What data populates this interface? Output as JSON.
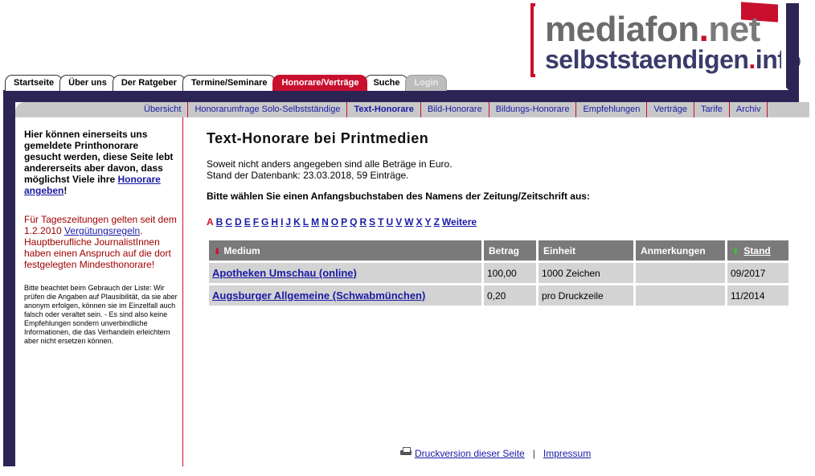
{
  "logo": {
    "line1_a": "mediafon",
    "line1_dot": ".",
    "line1_b": "net",
    "line2_a": "selbststaendigen",
    "line2_dot": ".",
    "line2_b": "info"
  },
  "tabs": [
    {
      "label": "Startseite"
    },
    {
      "label": "Über uns"
    },
    {
      "label": "Der Ratgeber"
    },
    {
      "label": "Termine/Seminare"
    },
    {
      "label": "Honorare/Verträge",
      "active": true
    },
    {
      "label": "Suche"
    },
    {
      "label": "Login",
      "disabled": true
    }
  ],
  "subnav": [
    {
      "label": "Übersicht"
    },
    {
      "label": "Honorarumfrage Solo-Selbstständige"
    },
    {
      "label": "Text-Honorare",
      "active": true
    },
    {
      "label": "Bild-Honorare"
    },
    {
      "label": "Bildungs-Honorare"
    },
    {
      "label": "Empfehlungen"
    },
    {
      "label": "Verträge"
    },
    {
      "label": "Tarife"
    },
    {
      "label": "Archiv"
    }
  ],
  "sidebar": {
    "intro": "Hier können einerseits uns gemeldete Printhonorare gesucht werden, diese Seite lebt andererseits aber davon, dass möglichst Viele ihre",
    "intro_link": "Honorare angeben",
    "intro_end": "!",
    "tz_start": "Für Tageszeitungen gelten seit dem 1.2.2010 ",
    "tz_link": "Vergütungsregeln",
    "tz_end": ". Hauptberufliche JournalistInnen haben einen Anspruch auf die dort festgelegten Mindesthonorare!",
    "note": "Bitte beachtet beim Gebrauch der Liste: Wir prüfen die Angaben auf Plausibilität, da sie aber anonym erfolgen, können sie im Einzelfall auch falsch oder veraltet sein. - Es sind also keine Empfehlungen sondern unverbindliche Informationen, die das Verhandeln erleichtern aber nicht ersetzen können."
  },
  "main": {
    "title": "Text-Honorare bei Printmedien",
    "info1": "Soweit nicht anders angegeben sind alle Beträge in Euro.",
    "info2": "Stand der Datenbank: 23.03.2018, 59 Einträge.",
    "choose": "Bitte wählen Sie einen Anfangsbuchstaben des Namens der Zeitung/Zeitschrift aus:",
    "letters": [
      "A",
      "B",
      "C",
      "D",
      "E",
      "F",
      "G",
      "H",
      "I",
      "J",
      "K",
      "L",
      "M",
      "N",
      "O",
      "P",
      "Q",
      "R",
      "S",
      "T",
      "U",
      "V",
      "W",
      "X",
      "Y",
      "Z",
      "Weitere"
    ],
    "current_letter": "A"
  },
  "table": {
    "headers": {
      "medium": "Medium",
      "betrag": "Betrag",
      "einheit": "Einheit",
      "anmerkungen": "Anmerkungen",
      "stand": "Stand"
    },
    "rows": [
      {
        "medium": "Apotheken Umschau (online)",
        "betrag": "100,00",
        "einheit": "1000 Zeichen",
        "anmerkungen": "",
        "stand": "09/2017"
      },
      {
        "medium": "Augsburger Allgemeine (Schwabmünchen)",
        "betrag": "0,20",
        "einheit": "pro Druckzeile",
        "anmerkungen": "",
        "stand": "11/2014"
      }
    ]
  },
  "footer": {
    "print": "Druckversion dieser Seite",
    "sep": "|",
    "impressum": "Impressum"
  }
}
